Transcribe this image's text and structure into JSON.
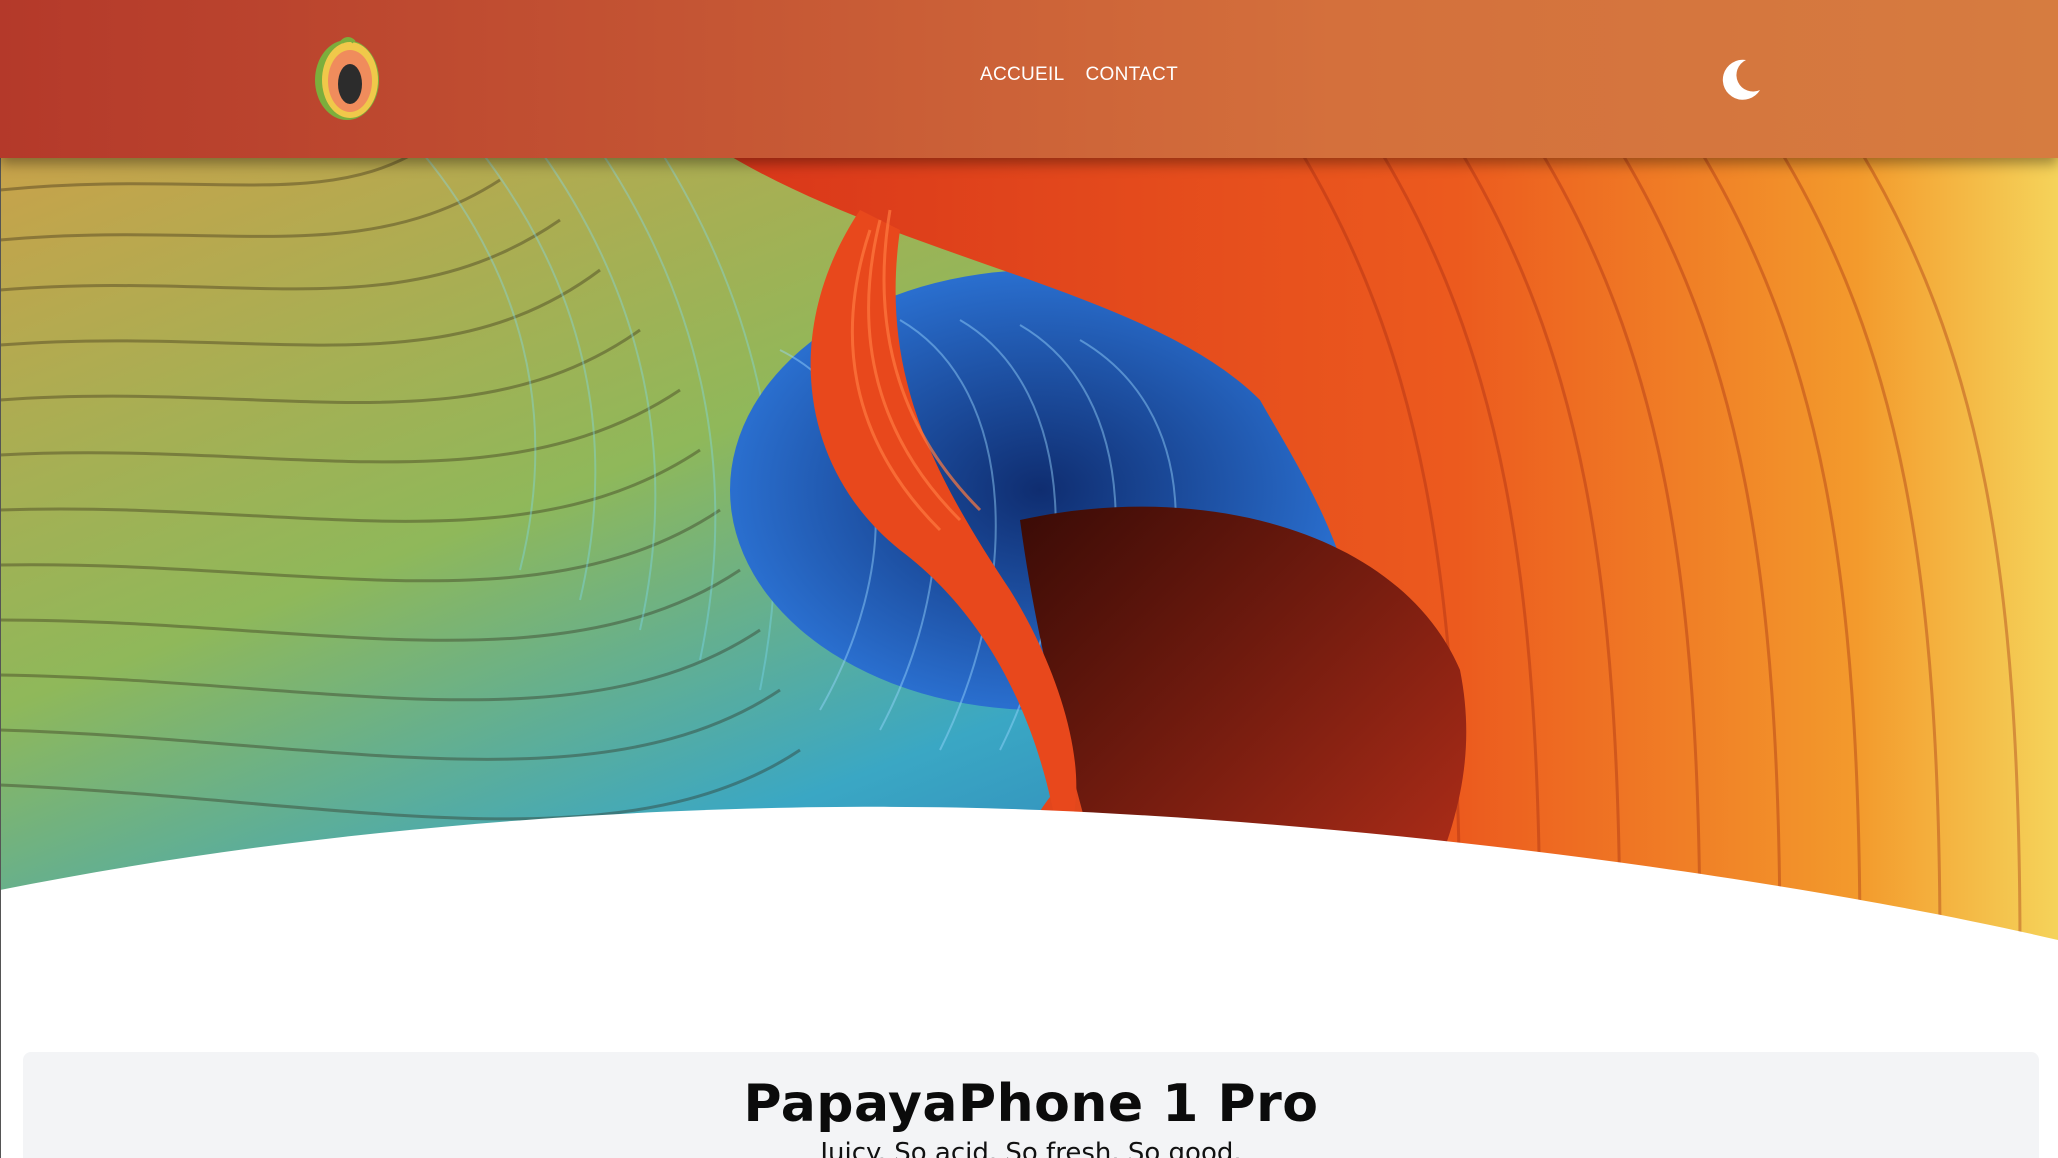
{
  "header": {
    "logo_icon": "papaya-logo-icon",
    "nav": [
      {
        "label": "ACCUEIL"
      },
      {
        "label": "CONTACT"
      }
    ],
    "theme_toggle_icon": "moon-icon",
    "colors": {
      "gradient_start": "#b4392a",
      "gradient_end": "#d67c40"
    }
  },
  "hero": {
    "image": "abstract-wave-artwork",
    "colors": {
      "orange": "#e2461e",
      "blue": "#1d4ea8",
      "yellow": "#e8b94a",
      "green": "#8fb85a"
    }
  },
  "product": {
    "title": "PapayaPhone 1 Pro",
    "subtitle": "Juicy. So acid. So fresh. So good."
  }
}
